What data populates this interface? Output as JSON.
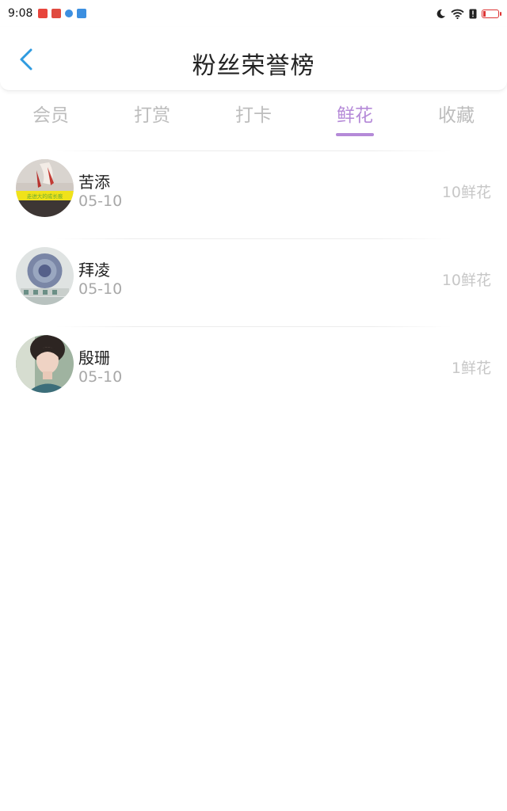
{
  "status_bar": {
    "time": "9:08",
    "app_icons": [
      {
        "name": "app-icon-red-o",
        "color": "#e8453c"
      },
      {
        "name": "app-icon-red-bar",
        "color": "#e04a3f"
      },
      {
        "name": "app-icon-blue-dot",
        "color": "#3c8fe0"
      },
      {
        "name": "cloud-icon",
        "color": "#3c8fe0"
      }
    ],
    "battery_color": "#dd3333"
  },
  "header": {
    "title": "粉丝荣誉榜",
    "back_icon": "chevron-left-icon",
    "back_color": "#2f9be0"
  },
  "tabs": [
    {
      "label": "会员",
      "active": false
    },
    {
      "label": "打赏",
      "active": false
    },
    {
      "label": "打卡",
      "active": false
    },
    {
      "label": "鲜花",
      "active": true
    },
    {
      "label": "收藏",
      "active": false
    }
  ],
  "accent_color": "#b58ad8",
  "fans": [
    {
      "name": "苦添",
      "date": "05-10",
      "count": "10鲜花",
      "avatar": "avatar-hand-yellow-banner",
      "avatar_caption": "走进大的成长痕"
    },
    {
      "name": "拜凌",
      "date": "05-10",
      "count": "10鲜花",
      "avatar": "avatar-emblem-badge"
    },
    {
      "name": "殷珊",
      "date": "05-10",
      "count": "1鲜花",
      "avatar": "avatar-woman-portrait"
    }
  ]
}
